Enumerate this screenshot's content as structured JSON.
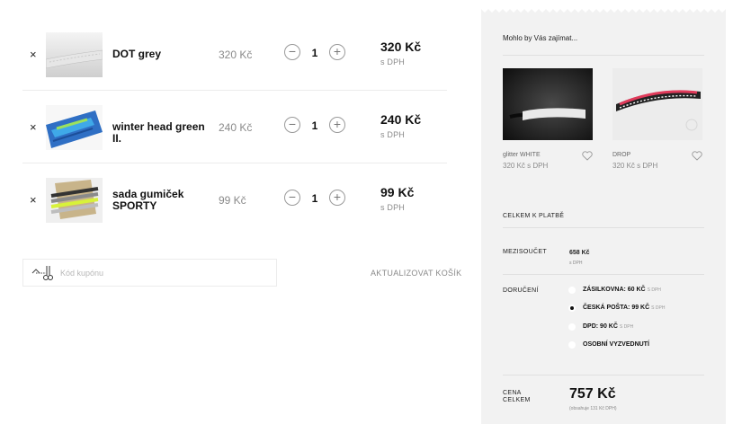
{
  "cart": {
    "remove_glyph": "×",
    "minus_glyph": "−",
    "plus_glyph": "+",
    "items": [
      {
        "name": "DOT grey",
        "unit_price": "320 Kč",
        "quantity": "1",
        "line_total": "320 Kč",
        "vat_note": "s DPH"
      },
      {
        "name": "winter head green II.",
        "unit_price": "240 Kč",
        "quantity": "1",
        "line_total": "240 Kč",
        "vat_note": "s DPH"
      },
      {
        "name": "sada gumiček SPORTY",
        "unit_price": "99 Kč",
        "quantity": "1",
        "line_total": "99 Kč",
        "vat_note": "s DPH"
      }
    ],
    "coupon_placeholder": "Kód kupónu",
    "update_label": "AKTUALIZOVAT KOŠÍK"
  },
  "sidebar": {
    "recommend_heading": "Mohlo by Vás zajímat...",
    "recommendations": [
      {
        "name": "glitter WHITE",
        "price": "320 Kč s DPH"
      },
      {
        "name": "DROP",
        "price": "320 Kč s DPH"
      }
    ],
    "totals_title": "CELKEM K PLATBĚ",
    "subtotal_label": "MEZISOUČET",
    "subtotal_value": "658 Kč",
    "subtotal_vat": "s DPH",
    "delivery_label": "DORUČENÍ",
    "shipping_options": [
      {
        "name": "ZÁSILKOVNA: 60 KČ",
        "vat": "S DPH",
        "selected": false
      },
      {
        "name": "ČESKÁ POŠTA: 99 KČ",
        "vat": "S DPH",
        "selected": true
      },
      {
        "name": "DPD: 90 KČ",
        "vat": "S DPH",
        "selected": false
      },
      {
        "name": "OSOBNÍ VYZVEDNUTÍ",
        "vat": "",
        "selected": false
      }
    ],
    "total_label": "CENA CELKEM",
    "total_value": "757 Kč",
    "total_vat_note": "(obsahuje 131 Kč DPH)"
  },
  "colors": {
    "sidebar_bg": "#f2f2f2",
    "muted_text": "#8a8a8a"
  }
}
